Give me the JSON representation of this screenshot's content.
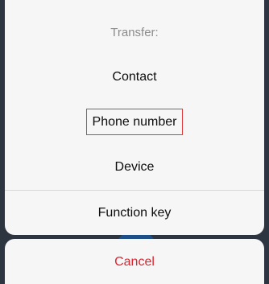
{
  "action_sheet": {
    "title": "Transfer:",
    "items": [
      {
        "label": "Contact"
      },
      {
        "label": "Phone number",
        "highlighted": true
      },
      {
        "label": "Device"
      },
      {
        "label": "Function key"
      }
    ],
    "cancel_label": "Cancel"
  },
  "colors": {
    "sheet_background": "#f6f6f6",
    "overlay_background": "#2d3540",
    "title_text": "#8b8b8b",
    "item_text": "#0d0d0d",
    "cancel_text": "#e0242f",
    "highlight_border": "#e03a3a"
  }
}
